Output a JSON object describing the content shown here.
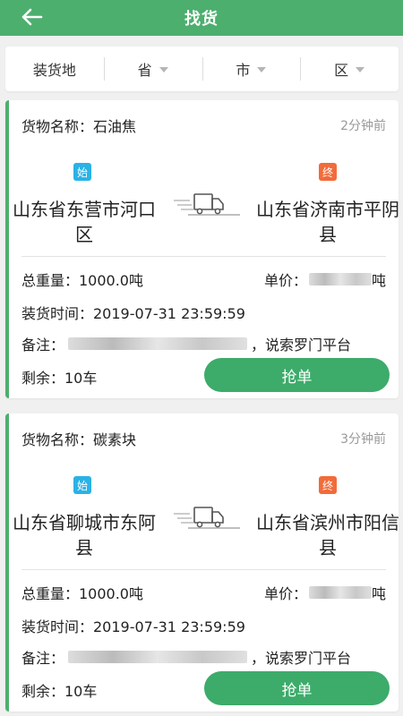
{
  "header": {
    "title": "找货"
  },
  "filters": {
    "loading_place": "装货地",
    "province": "省",
    "city": "市",
    "district": "区"
  },
  "cards": [
    {
      "goods": "货物名称：石油焦",
      "time_ago": "2分钟前",
      "start_badge": "始",
      "end_badge": "终",
      "from": "山东省东营市河口区",
      "to": "山东省济南市平阴县",
      "weight": "总重量：1000.0吨",
      "price_label": "单价：",
      "price_unit": "吨",
      "loading_time": "装货时间：2019-07-31 23:59:59",
      "note_label": "备注：",
      "note_tail": "，说索罗门平台",
      "remaining": "剩余：10车",
      "grab_label": "抢单"
    },
    {
      "goods": "货物名称：碳素块",
      "time_ago": "3分钟前",
      "start_badge": "始",
      "end_badge": "终",
      "from": "山东省聊城市东阿县",
      "to": "山东省滨州市阳信县",
      "weight": "总重量：1000.0吨",
      "price_label": "单价：",
      "price_unit": "吨",
      "loading_time": "装货时间：2019-07-31 23:59:59",
      "note_label": "备注：",
      "note_tail": "，说索罗门平台",
      "remaining": "剩余：10车",
      "grab_label": "抢单"
    }
  ],
  "colors": {
    "brand_green": "#4caf6e",
    "start_badge": "#2ab2e6",
    "end_badge": "#f26b3a"
  }
}
